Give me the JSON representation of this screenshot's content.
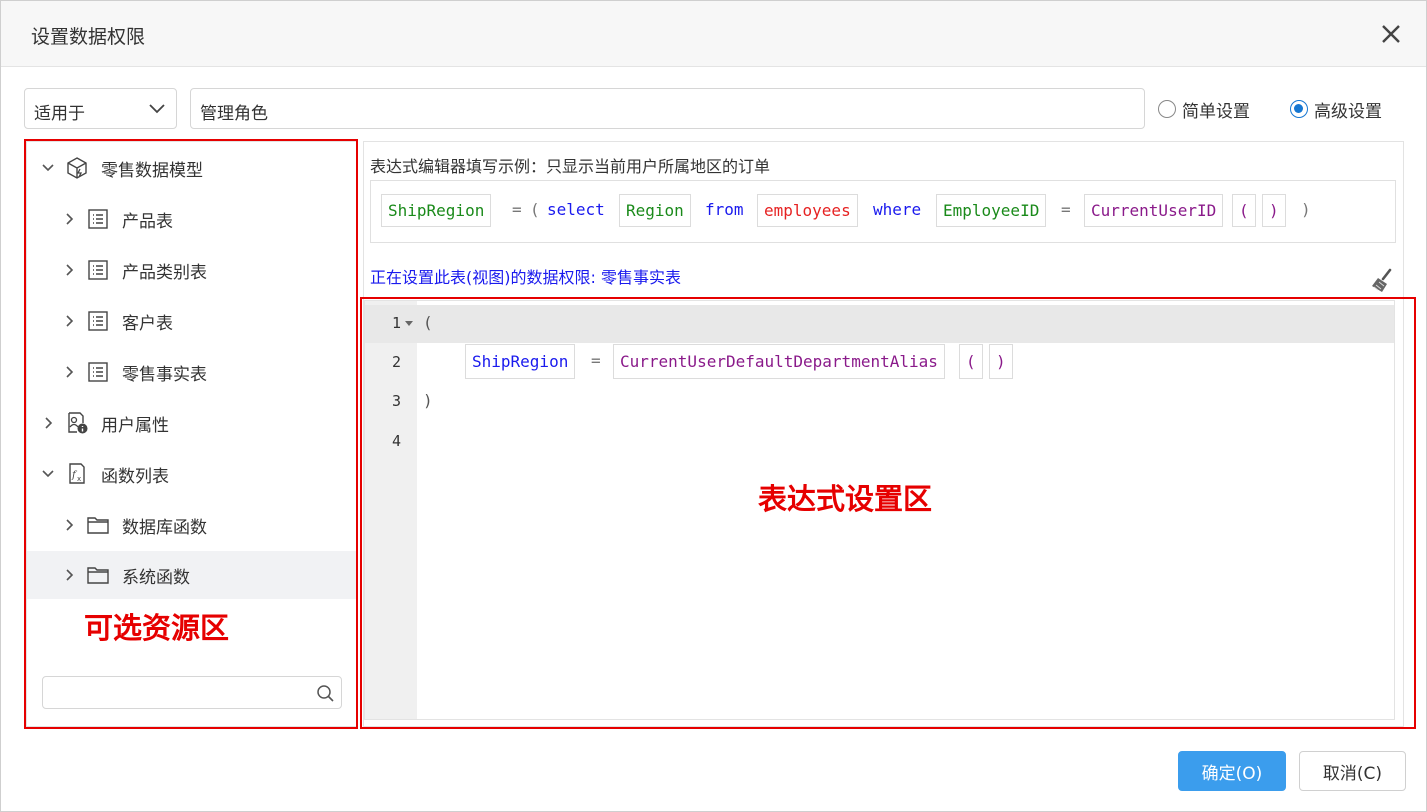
{
  "dialog": {
    "title": "设置数据权限"
  },
  "toolbar": {
    "apply_to": "适用于",
    "role": "管理角色",
    "mode_simple": "简单设置",
    "mode_advanced": "高级设置",
    "selected_mode": "advanced"
  },
  "tree": {
    "items": [
      {
        "label": "零售数据模型",
        "icon": "cube-icon",
        "expanded": true
      },
      {
        "label": "产品表",
        "icon": "table-icon",
        "expanded": false
      },
      {
        "label": "产品类别表",
        "icon": "table-icon",
        "expanded": false
      },
      {
        "label": "客户表",
        "icon": "table-icon",
        "expanded": false
      },
      {
        "label": "零售事实表",
        "icon": "table-icon",
        "expanded": false
      },
      {
        "label": "用户属性",
        "icon": "user-attribute-icon",
        "expanded": false
      },
      {
        "label": "函数列表",
        "icon": "function-icon",
        "expanded": true
      },
      {
        "label": "数据库函数",
        "icon": "folder-icon",
        "expanded": false
      },
      {
        "label": "系统函数",
        "icon": "folder-icon",
        "expanded": false
      }
    ],
    "search_placeholder": ""
  },
  "editor": {
    "hint": "表达式编辑器填写示例：只显示当前用户所属地区的订单",
    "example_tokens": [
      "ShipRegion",
      "=",
      "(",
      "select",
      "Region",
      "from",
      "employees",
      "where",
      "EmployeeID",
      "=",
      "CurrentUserID",
      "(",
      ")",
      ")"
    ],
    "current_label": "正在设置此表(视图)的数据权限: 零售事实表",
    "line_numbers": [
      "1",
      "2",
      "3",
      "4"
    ],
    "code": {
      "line1": "(",
      "line2_tokens": [
        "ShipRegion",
        "=",
        "CurrentUserDefaultDepartmentAlias",
        "(",
        ")"
      ],
      "line3": ")"
    }
  },
  "annotations": {
    "resource_area": "可选资源区",
    "expression_area": "表达式设置区"
  },
  "buttons": {
    "ok": "确定(O)",
    "cancel": "取消(C)"
  },
  "colors": {
    "accent": "#3b9ded",
    "annotation": "#e60000",
    "keyword": "#1a1aee",
    "field": "#1a8a1a",
    "table": "#e62222",
    "function": "#8a1a8a"
  }
}
